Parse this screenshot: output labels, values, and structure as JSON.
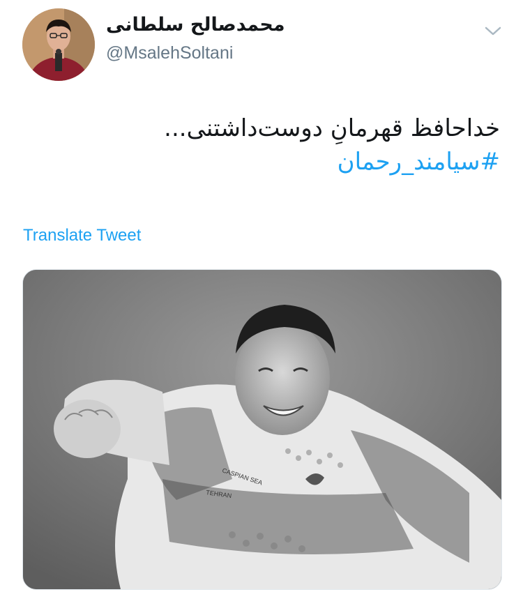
{
  "author": {
    "display_name": "محمدصالح سلطانی",
    "handle": "@MsalehSoltani"
  },
  "tweet": {
    "text": "خداحافظ قهرمانِ دوست‌داشتنی...",
    "hashtag": "#سیامند_رحمان"
  },
  "actions": {
    "translate_label": "Translate Tweet",
    "more_icon": "chevron-down-icon"
  },
  "media": {
    "image_icon": "photo-icon",
    "jersey_texts": [
      "CASPIAN SEA",
      "TEHRAN"
    ]
  },
  "colors": {
    "link": "#1da1f2",
    "secondary_text": "#657786",
    "primary_text": "#14171a"
  }
}
